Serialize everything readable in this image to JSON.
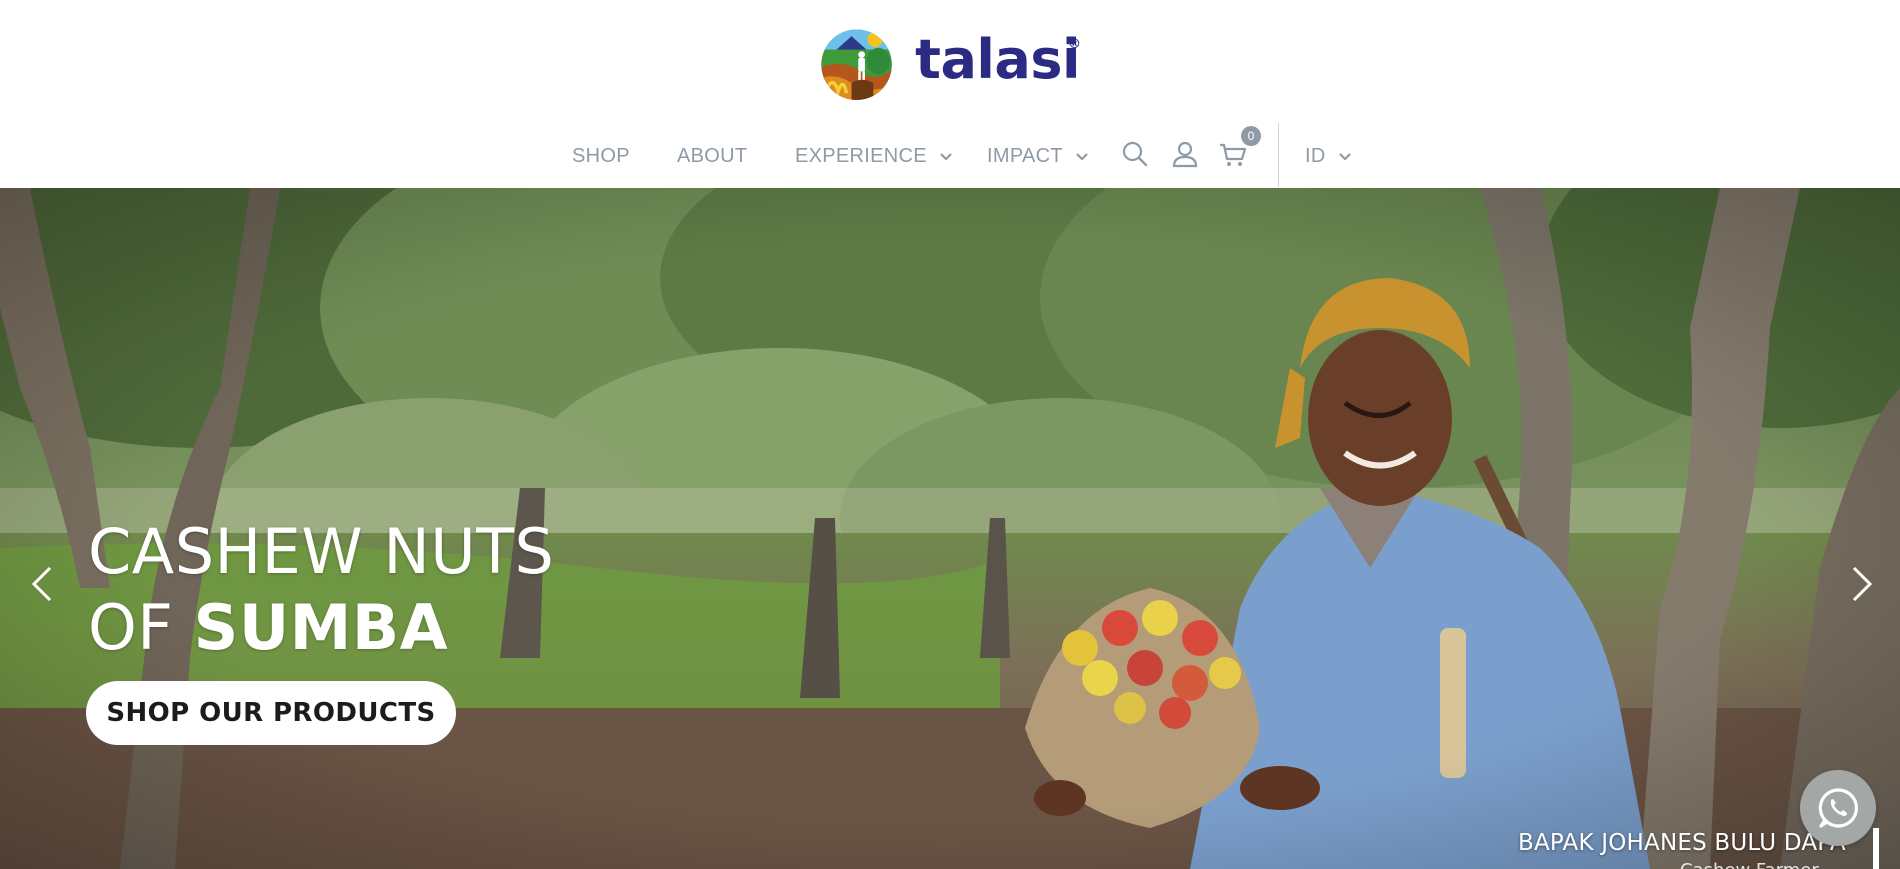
{
  "brand": {
    "name": "talasi",
    "trademark": "®"
  },
  "nav": {
    "shop": "SHOP",
    "about": "ABOUT",
    "experience": "EXPERIENCE",
    "impact": "IMPACT",
    "language": "ID",
    "cart_count": "0",
    "icons": [
      "search-icon",
      "user-icon",
      "cart-icon",
      "chevron-down-icon"
    ]
  },
  "hero": {
    "title_line1": "CASHEW NUTS",
    "title_line2_prefix": "OF ",
    "title_line2_bold": "SUMBA",
    "cta_label": "SHOP OUR PRODUCTS",
    "caption": "BAPAK JOHANES BULU DAPA",
    "caption_sub": "Cashew Farmer"
  },
  "colors": {
    "brand_blue": "#2b2b84",
    "nav_text": "#8e9aa6",
    "whatsapp_button": "#a3a8a6"
  }
}
